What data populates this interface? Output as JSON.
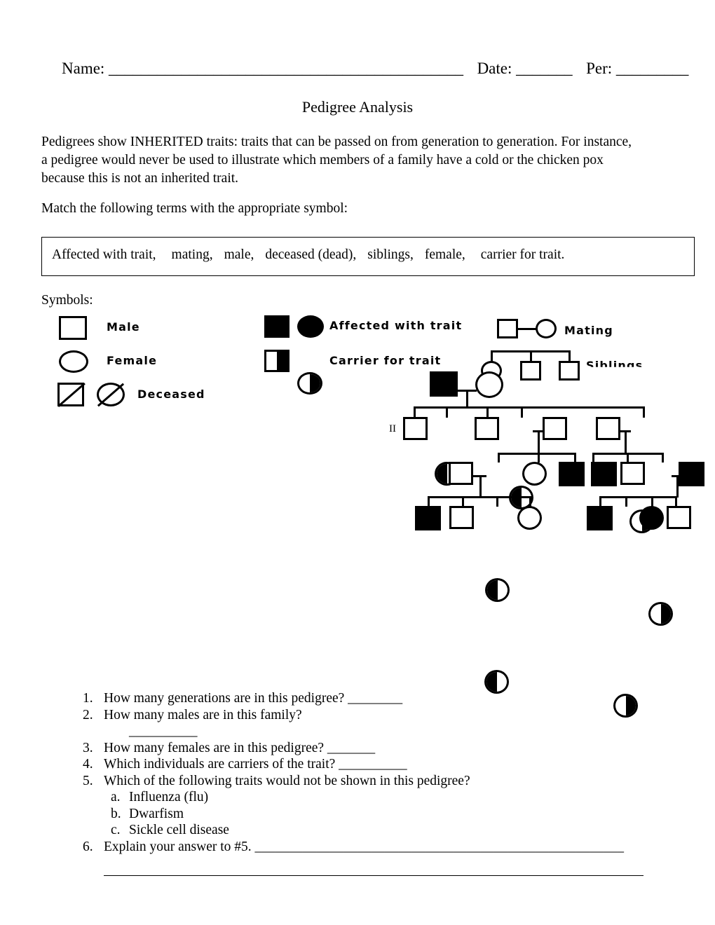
{
  "header": {
    "name_label": "Name: ____________________________________________",
    "date_label": "Date: _______",
    "per_label": "Per: _________",
    "title": "Pedigree Analysis"
  },
  "intro": {
    "paragraph": "Pedigrees show INHERITED traits: traits that can be passed on from generation to generation.  For instance, a pedigree would never be used to illustrate which members of a family have a cold or the chicken pox because this is not an inherited trait.",
    "match_instruction": "Match the following terms with the appropriate symbol:"
  },
  "word_bank": {
    "terms": [
      "Affected with trait,",
      "mating,",
      "male,",
      "deceased (dead),",
      "siblings,",
      "female,",
      "carrier for trait."
    ]
  },
  "symbols_section": {
    "label": "Symbols:",
    "legend": {
      "male": "Male",
      "female": "Female",
      "deceased": "Deceased",
      "affected": "Affected with trait",
      "carrier": "Carrier for trait",
      "mating": "Mating",
      "siblings": "Siblings"
    }
  },
  "pedigree": {
    "generation_label_ii": "II",
    "generation_i": [
      {
        "shape": "square",
        "fill": "affected"
      },
      {
        "shape": "circle",
        "fill": "unaffected"
      }
    ],
    "generation_ii": [
      {
        "shape": "square",
        "fill": "unaffected"
      },
      {
        "shape": "circle",
        "fill": "carrier-left"
      },
      {
        "shape": "square",
        "fill": "unaffected"
      },
      {
        "shape": "circle",
        "fill": "carrier-left"
      },
      {
        "shape": "square",
        "fill": "unaffected"
      },
      {
        "shape": "square",
        "fill": "unaffected"
      },
      {
        "shape": "circle",
        "fill": "carrier-right"
      }
    ],
    "generation_iii": [
      {
        "shape": "square",
        "fill": "unaffected"
      },
      {
        "shape": "circle",
        "fill": "carrier-left"
      },
      {
        "shape": "circle",
        "fill": "unaffected"
      },
      {
        "shape": "square",
        "fill": "affected"
      },
      {
        "shape": "square",
        "fill": "affected"
      },
      {
        "shape": "square",
        "fill": "unaffected"
      },
      {
        "shape": "circle",
        "fill": "carrier-right"
      },
      {
        "shape": "square",
        "fill": "affected"
      }
    ],
    "generation_iv_left": [
      {
        "shape": "square",
        "fill": "affected"
      },
      {
        "shape": "square",
        "fill": "unaffected"
      },
      {
        "shape": "circle",
        "fill": "carrier-left"
      },
      {
        "shape": "circle",
        "fill": "unaffected"
      }
    ],
    "generation_iv_right": [
      {
        "shape": "square",
        "fill": "affected"
      },
      {
        "shape": "circle",
        "fill": "carrier-right"
      },
      {
        "shape": "circle",
        "fill": "affected"
      },
      {
        "shape": "square",
        "fill": "unaffected"
      }
    ]
  },
  "questions": [
    {
      "num": "1.",
      "text": "How many generations are in this pedigree? ________"
    },
    {
      "num": "2.",
      "text": "How many males are in this family?",
      "blank": "__________"
    },
    {
      "num": "3.",
      "text": "How many females are in this pedigree? _______"
    },
    {
      "num": "4.",
      "text": "Which individuals are carriers of the trait? __________"
    },
    {
      "num": "5.",
      "text": "Which of the following traits would not be shown in this pedigree?"
    },
    {
      "num": "6.",
      "text": "Explain your answer to #5. ______________________________________________________"
    }
  ],
  "question5_options": [
    {
      "num": "a.",
      "text": "Influenza (flu)"
    },
    {
      "num": "b.",
      "text": "Dwarfism"
    },
    {
      "num": "c.",
      "text": "Sickle cell disease"
    }
  ]
}
